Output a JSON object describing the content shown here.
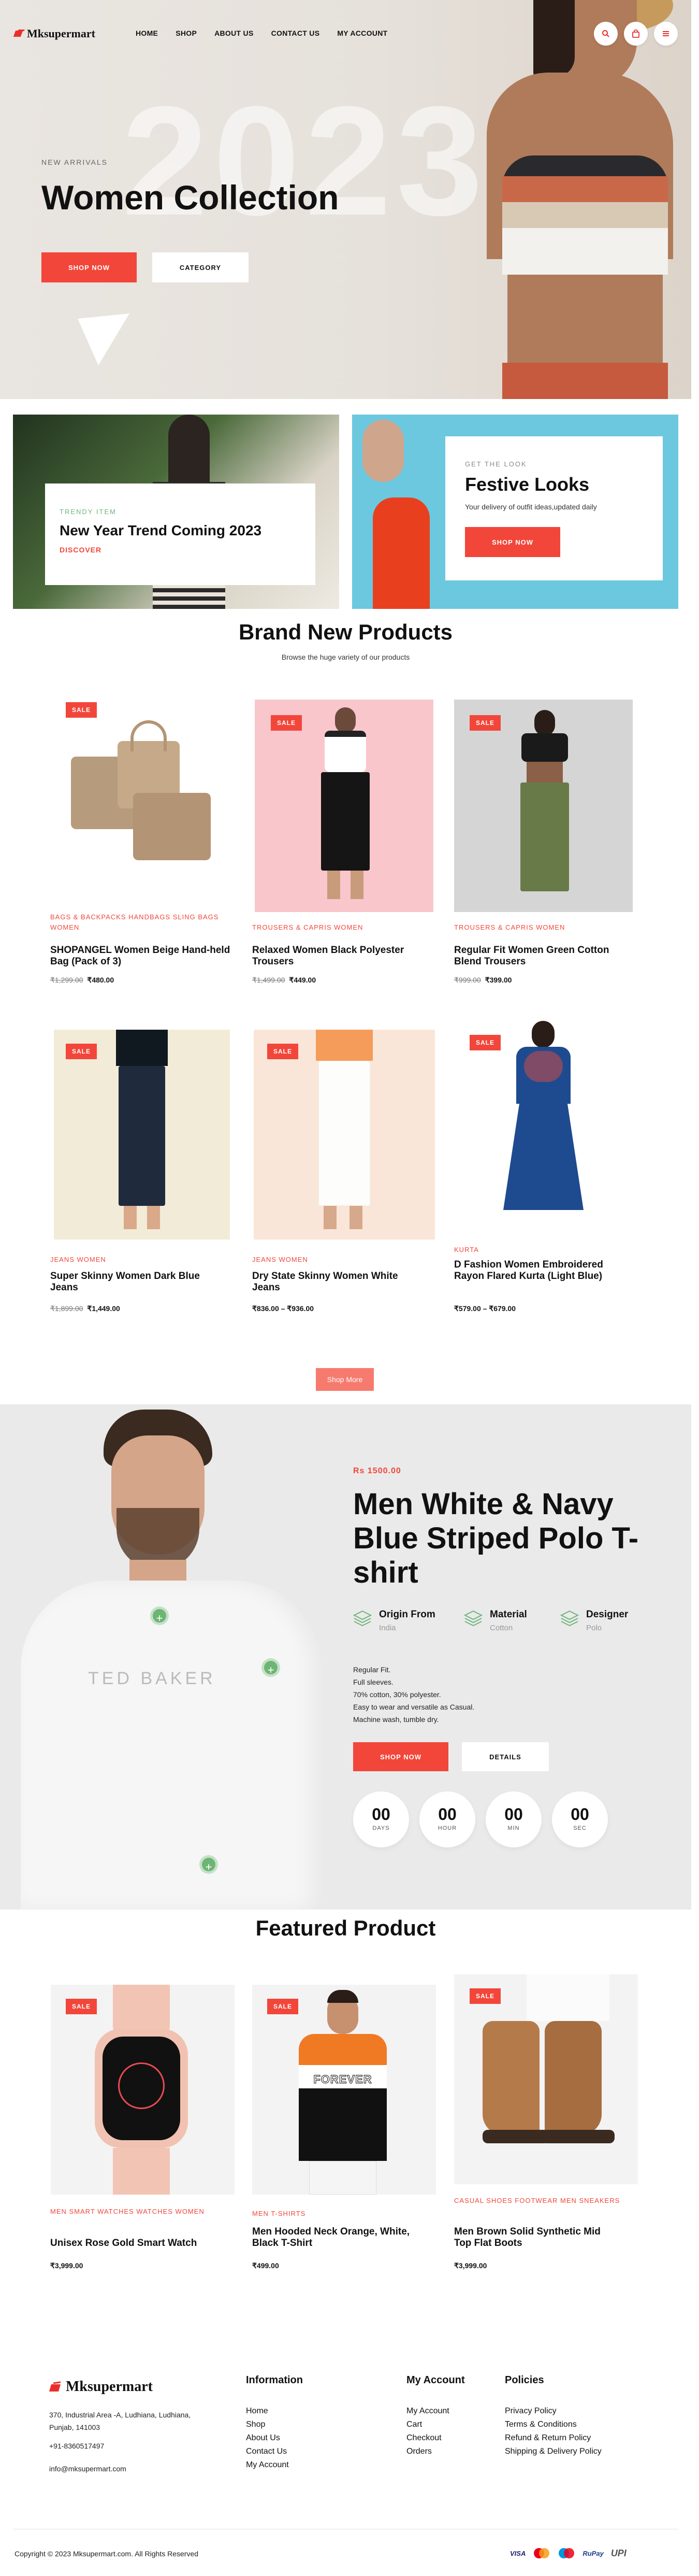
{
  "header": {
    "logo_text": "Mksupermart",
    "nav": [
      "HOME",
      "SHOP",
      "ABOUT US",
      "CONTACT US",
      "MY ACCOUNT"
    ],
    "icons": [
      "search-icon",
      "bag-icon",
      "menu-icon"
    ],
    "year": "2023",
    "eyebrow": "NEW ARRIVALS",
    "title": "Women Collection",
    "primary_button": "SHOP NOW",
    "secondary_button": "CATEGORY"
  },
  "promos": [
    {
      "eyebrow": "TRENDY ITEM",
      "title": "New Year Trend Coming 2023",
      "link": "DISCOVER"
    },
    {
      "eyebrow": "GET THE LOOK",
      "title": "Festive Looks",
      "text": "Your delivery of outfit ideas,updated daily",
      "button": "SHOP NOW"
    }
  ],
  "brand_new": {
    "title": "Brand New Products",
    "subtitle": "Browse the huge variety of our products",
    "sale_label": "SALE",
    "products": [
      {
        "cat": "BAGS & BACKPACKS HANDBAGS SLING BAGS WOMEN",
        "name": "SHOPANGEL Women Beige Hand-held Bag (Pack of 3)",
        "old": "₹1,299.00",
        "price": "₹480.00"
      },
      {
        "cat": "TROUSERS & CAPRIS WOMEN",
        "name": "Relaxed Women Black Polyester Trousers",
        "old": "₹1,499.00",
        "price": "₹449.00"
      },
      {
        "cat": "TROUSERS & CAPRIS WOMEN",
        "name": "Regular Fit Women Green Cotton Blend Trousers",
        "old": "₹999.00",
        "price": "₹399.00"
      },
      {
        "cat": "JEANS WOMEN",
        "name": "Super Skinny Women Dark Blue Jeans",
        "old": "₹1,899.00",
        "price": "₹1,449.00"
      },
      {
        "cat": "JEANS WOMEN",
        "name": "Dry State Skinny Women White Jeans",
        "old": "",
        "price": "₹836.00 – ₹936.00"
      },
      {
        "cat": "KURTA",
        "name": "D Fashion Women Embroidered Rayon Flared Kurta (Light Blue)",
        "old": "",
        "price": "₹579.00 – ₹679.00"
      }
    ],
    "more_button": "Shop More"
  },
  "deal": {
    "price": "Rs 1500.00",
    "title": "Men White & Navy Blue Striped Polo T-shirt",
    "features": [
      {
        "icon": "layers-icon",
        "title": "Origin From",
        "value": "India"
      },
      {
        "icon": "layers-icon",
        "title": "Material",
        "value": "Cotton"
      },
      {
        "icon": "layers-icon",
        "title": "Designer",
        "value": "Polo"
      }
    ],
    "description": [
      "Regular Fit.",
      "Full sleeves.",
      "70% cotton, 30% polyester.",
      "Easy to wear and versatile as Casual.",
      "Machine wash, tumble dry."
    ],
    "primary_button": "SHOP NOW",
    "secondary_button": "DETAILS",
    "countdown": [
      {
        "value": "00",
        "label": "DAYS"
      },
      {
        "value": "00",
        "label": "HOUR"
      },
      {
        "value": "00",
        "label": "MIN"
      },
      {
        "value": "00",
        "label": "SEC"
      }
    ],
    "shirt_print": "TED BAKER"
  },
  "featured": {
    "title": "Featured Product",
    "sale_label": "SALE",
    "products": [
      {
        "cat": "MEN SMART WATCHES WATCHES WOMEN",
        "name": "Unisex Rose Gold Smart Watch",
        "price": "₹3,999.00"
      },
      {
        "cat": "MEN T-SHIRTS",
        "name": "Men Hooded Neck Orange, White, Black T-Shirt",
        "price": "₹499.00",
        "print": "FOREVER"
      },
      {
        "cat": "CASUAL SHOES FOOTWEAR MEN SNEAKERS",
        "name": "Men Brown Solid Synthetic Mid Top Flat Boots",
        "price": "₹3,999.00"
      }
    ]
  },
  "footer": {
    "logo_text": "Mksupermart",
    "address_line1": "370, Industrial Area -A, Ludhiana, Ludhiana,",
    "address_line2": "Punjab, 141003",
    "phone": "+91-8360517497",
    "email": "info@mksupermart.com",
    "columns": [
      {
        "title": "Information",
        "items": [
          "Home",
          "Shop",
          "About Us",
          "Contact Us",
          "My Account"
        ]
      },
      {
        "title": "My Account",
        "items": [
          "My Account",
          "Cart",
          "Checkout",
          "Orders"
        ]
      },
      {
        "title": "Policies",
        "items": [
          "Privacy Policy",
          "Terms & Conditions",
          "Refund & Return Policy",
          "Shipping & Delivery Policy"
        ]
      }
    ],
    "copyright": "Copyright © 2023 Mksupermart.com. All Rights Reserved",
    "payments": [
      "VISA",
      "mastercard",
      "maestro",
      "RuPay",
      "UPI"
    ]
  },
  "colors": {
    "accent": "#f2463a",
    "green": "#6db574"
  }
}
